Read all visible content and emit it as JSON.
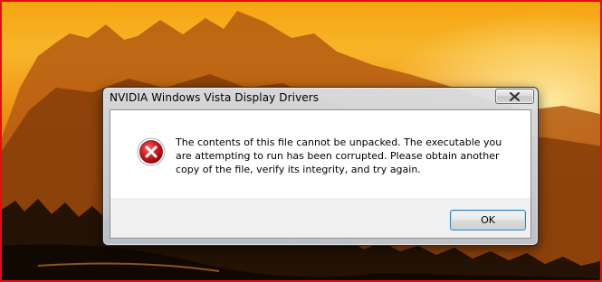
{
  "dialog": {
    "title": "NVIDIA Windows Vista Display Drivers",
    "message": "The contents of this file cannot be unpacked. The executable you are attempting to run has been corrupted. Please obtain another copy of the file, verify its integrity, and try again.",
    "ok_label": "OK",
    "icon": "error-icon",
    "close_icon": "close-icon"
  },
  "colors": {
    "frame_border": "#e01010",
    "error_red": "#c8141c",
    "ok_focus_border": "#3c7fb1"
  }
}
